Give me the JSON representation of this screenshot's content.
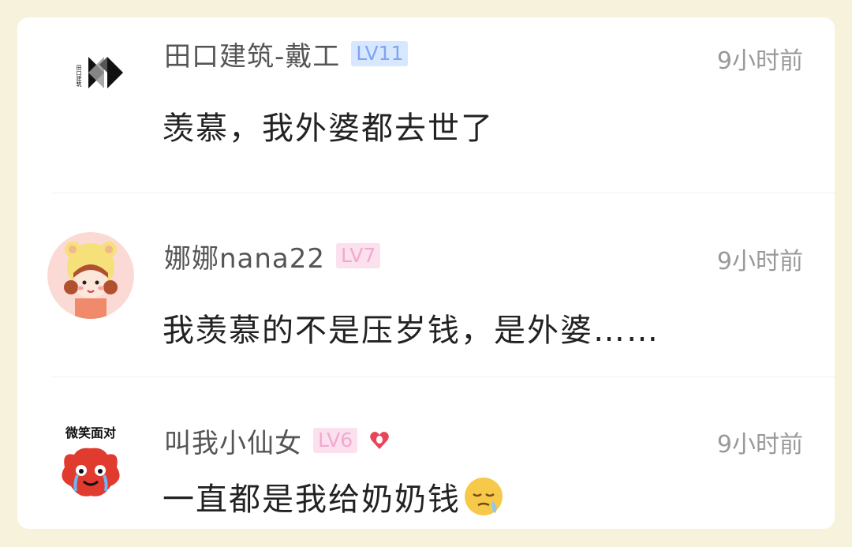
{
  "comments": [
    {
      "username": "田口建筑-戴工",
      "level": "LV11",
      "time": "9小时前",
      "text": "羡慕，我外婆都去世了",
      "avatar_text": "田口建筑"
    },
    {
      "username": "娜娜nana22",
      "level": "LV7",
      "time": "9小时前",
      "text": "我羡慕的不是压岁钱，是外婆……"
    },
    {
      "username": "叫我小仙女",
      "level": "LV6",
      "time": "9小时前",
      "text": "一直都是我给奶奶钱",
      "avatar_text": "微笑面对",
      "badge_icon": "heart-icon",
      "emoji_icon": "sleepy-face-icon"
    }
  ],
  "colors": {
    "background": "#f7f2dc",
    "level_blue": "#7ea5f0",
    "level_pink": "#f3a9cf"
  }
}
